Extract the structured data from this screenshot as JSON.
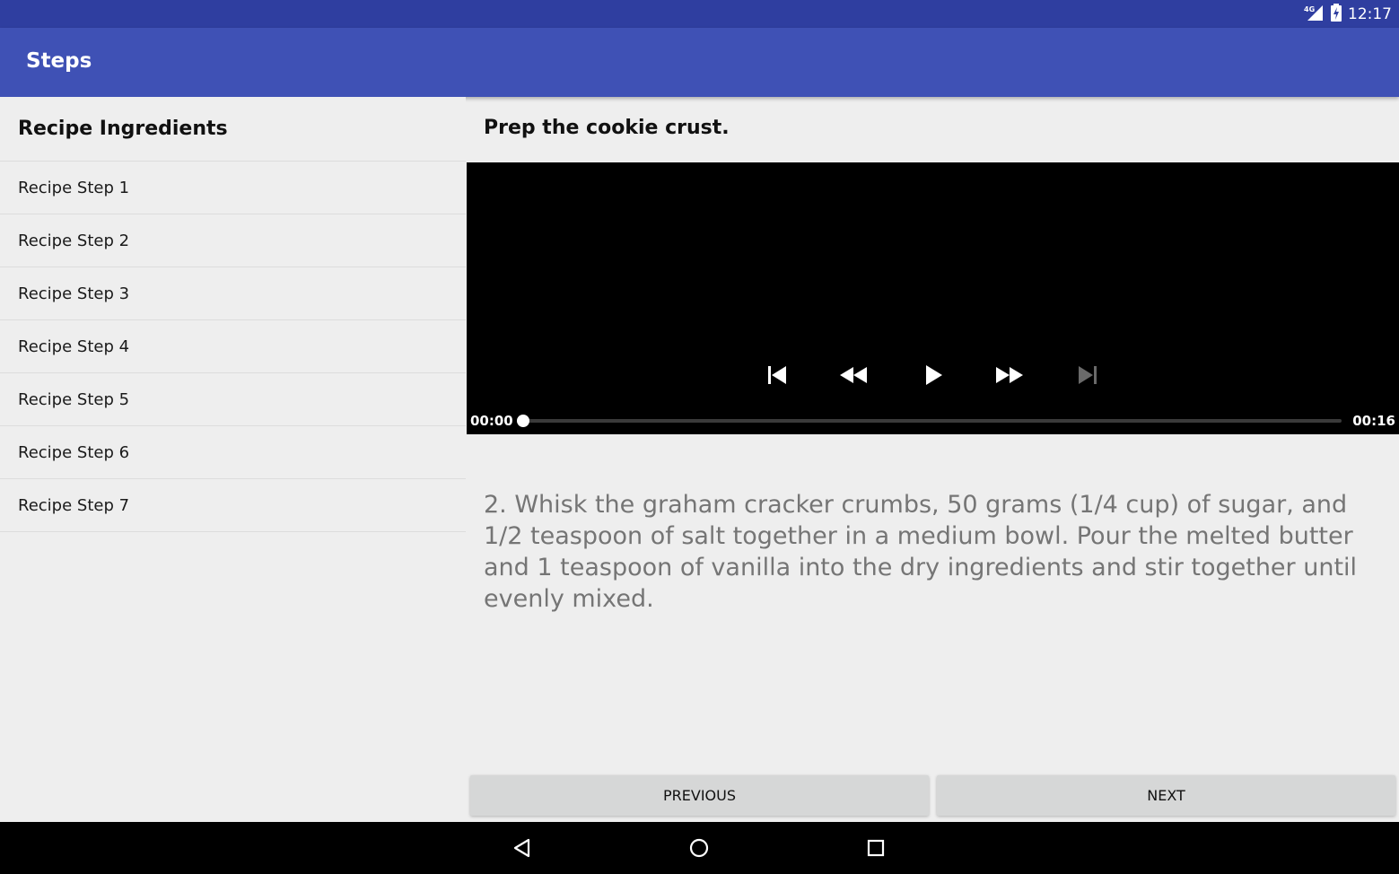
{
  "status_bar": {
    "network_label": "4G",
    "network_icon": "cell-signal-icon",
    "battery_icon": "battery-charging-icon",
    "time": "12:17"
  },
  "app_bar": {
    "title": "Steps"
  },
  "sidebar": {
    "header": "Recipe Ingredients",
    "items": [
      {
        "label": "Recipe Step 1"
      },
      {
        "label": "Recipe Step 2"
      },
      {
        "label": "Recipe Step 3"
      },
      {
        "label": "Recipe Step 4"
      },
      {
        "label": "Recipe Step 5"
      },
      {
        "label": "Recipe Step 6"
      },
      {
        "label": "Recipe Step 7"
      }
    ]
  },
  "step": {
    "title": "Prep the cookie crust.",
    "description": "2. Whisk the graham cracker crumbs, 50 grams (1/4 cup) of sugar, and 1/2 teaspoon of salt together in a medium bowl. Pour the melted butter and 1 teaspoon of vanilla into the dry ingredients and stir together until evenly mixed."
  },
  "player": {
    "position_label": "00:00",
    "duration_label": "00:16",
    "progress_fraction": 0,
    "controls": [
      "skip-previous-icon",
      "rewind-icon",
      "play-icon",
      "fast-forward-icon",
      "skip-next-icon"
    ],
    "next_disabled": true
  },
  "navigation": {
    "previous_label": "PREVIOUS",
    "next_label": "NEXT"
  },
  "system_nav": {
    "icons": [
      "back-icon",
      "home-icon",
      "recents-icon"
    ]
  },
  "colors": {
    "status_bar": "#2f3ea0",
    "app_bar": "#3f51b5",
    "background": "#eeeeee",
    "button": "#d6d7d7",
    "description_text": "#757575"
  }
}
